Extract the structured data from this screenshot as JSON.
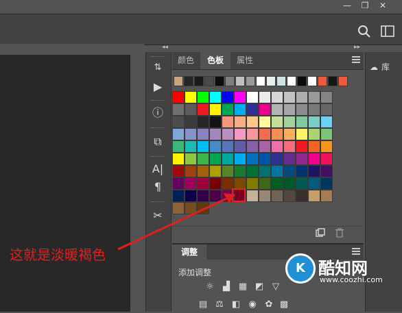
{
  "window": {
    "minimize_glyph": "—",
    "restore_glyph": "❐"
  },
  "tabs": [
    {
      "label": "颜色",
      "active": false
    },
    {
      "label": "色板",
      "active": true
    },
    {
      "label": "属性",
      "active": false
    }
  ],
  "library": {
    "label": "库"
  },
  "adjustments": {
    "tab_label": "调整",
    "add_label": "添加调整"
  },
  "annotation": {
    "text": "这就是淡暖褐色",
    "color": "#e02020"
  },
  "watermark": {
    "name": "酷知网",
    "url": "www.coozhi.com"
  },
  "highlighted_swatch": {
    "color": "#c69c6d"
  },
  "swatches": {
    "recent": [
      "#c7a57c",
      "#262626",
      "#1a1a1a",
      "#4a4a4a",
      "#0d0d0d",
      "#7f7f7f",
      "#bfbfbf",
      "#9a9a9a",
      "#ffffff",
      "#e6f0f0",
      "#cfe2e6",
      "#ffffff",
      "#0a0a0a",
      "#ffffff",
      "#ef5a3c",
      "#161616",
      "#ef5a3c"
    ],
    "grid": [
      [
        "#ff0000",
        "#ffff00",
        "#00ff00",
        "#00ffff",
        "#0000ff",
        "#ff00ff",
        "#ffffff",
        "#ebebeb",
        "#d6d6d6",
        "#c2c2c2",
        "#adadad",
        "#999999",
        "#858585"
      ],
      [
        "#707070",
        "#5c5c5c",
        "#ed1c24",
        "#fff200",
        "#00a651",
        "#00aeef",
        "#2e3192",
        "#ec008c",
        "#b3b3b3",
        "#a6a6a6",
        "#8c8c8c",
        "#7a7a7a",
        "#666666"
      ],
      [
        "#4d4d4d",
        "#3b3b3b",
        "#262626",
        "#121212",
        "#f7977a",
        "#f9ad81",
        "#fdc68a",
        "#fff79a",
        "#c4df9b",
        "#a2d39c",
        "#82ca9d",
        "#7bcdc8",
        "#6ecff6"
      ],
      [
        "#7ea7d8",
        "#8493ca",
        "#8882be",
        "#a187be",
        "#bc8dbf",
        "#f49ac2",
        "#f6989d",
        "#f26c4f",
        "#f68e55",
        "#fbaf5c",
        "#fff467",
        "#acd372",
        "#7cc576"
      ],
      [
        "#3bb878",
        "#1abbb4",
        "#00bff3",
        "#438cca",
        "#5574b9",
        "#605ca8",
        "#855fa8",
        "#a763a8",
        "#f06ea9",
        "#f26d7d",
        "#ed1c24",
        "#f26522",
        "#f7941d"
      ],
      [
        "#fff200",
        "#8dc63f",
        "#39b54a",
        "#00a651",
        "#00a99d",
        "#00aeef",
        "#0072bc",
        "#0054a6",
        "#2e3192",
        "#662d91",
        "#92278f",
        "#ec008c",
        "#ed145b"
      ],
      [
        "#9e0b0f",
        "#a0410d",
        "#a36209",
        "#aba000",
        "#598527",
        "#1a7b30",
        "#007236",
        "#00746b",
        "#0076a3",
        "#004b80",
        "#003471",
        "#1b1464",
        "#440e62"
      ],
      [
        "#630460",
        "#9e005d",
        "#9e0039",
        "#790000",
        "#7b2e00",
        "#7d4900",
        "#827b00",
        "#406618",
        "#005e20",
        "#005826",
        "#005952",
        "#005b7f",
        "#003663"
      ],
      [
        "#002157",
        "#0d004c",
        "#32004b",
        "#4b0049",
        "#7b0046",
        "#7a0026",
        "#c7b299",
        "#998675",
        "#736357",
        "#534741",
        "#37302d",
        "#c69c6d",
        "#a67c52"
      ],
      [
        "#8c6239",
        "#754c24",
        "#603913"
      ]
    ]
  },
  "icons": [
    "search-icon",
    "workspace-icon",
    "collapse-icon",
    "play-icon",
    "info-icon",
    "layer-comp-icon",
    "char-icon",
    "paragraph-icon",
    "tools-icon",
    "new-swatch-icon",
    "trash-icon",
    "panel-menu-icon",
    "creative-cloud-icon",
    "brightness-icon",
    "levels-icon",
    "curves-icon",
    "exposure-icon",
    "vibrance-icon",
    "hue-icon",
    "balance-icon",
    "bw-icon",
    "camera-icon",
    "mixer-icon",
    "grid-icon"
  ]
}
